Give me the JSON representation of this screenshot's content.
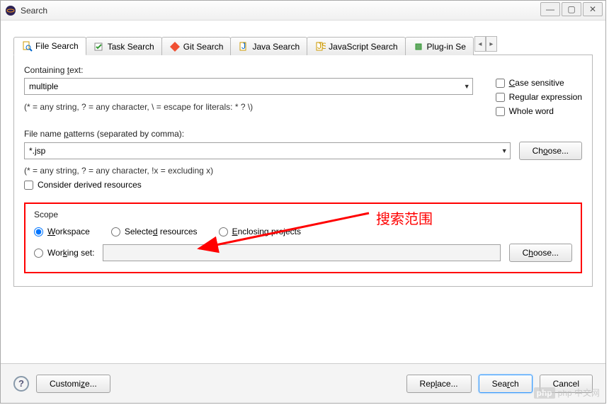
{
  "window": {
    "title": "Search",
    "min": "—",
    "max": "▢",
    "close": "✕"
  },
  "tabs": {
    "file": "File Search",
    "task": "Task Search",
    "git": "Git Search",
    "java": "Java Search",
    "js": "JavaScript Search",
    "plugin": "Plug-in Se",
    "left": "◂",
    "right": "▸"
  },
  "containing": {
    "label": "Containing text:",
    "value": "multiple",
    "hint": "(* = any string, ? = any character, \\ = escape for literals: * ? \\)"
  },
  "options": {
    "case": "Case sensitive",
    "regex": "Regular expression",
    "whole": "Whole word"
  },
  "patterns": {
    "label": "File name patterns (separated by comma):",
    "value": "*.jsp",
    "choose": "Choose...",
    "hint": "(* = any string, ? = any character, !x = excluding x)",
    "derived": "Consider derived resources"
  },
  "scope": {
    "title": "Scope",
    "workspace": "Workspace",
    "selected": "Selected resources",
    "enclosing": "Enclosing projects",
    "workingset": "Working set:",
    "choose": "Choose..."
  },
  "annotation": {
    "text": "搜索范围"
  },
  "buttons": {
    "help": "?",
    "customize": "Customize...",
    "replace": "Replace...",
    "search": "Search",
    "cancel": "Cancel"
  },
  "watermark": "php 中文网"
}
